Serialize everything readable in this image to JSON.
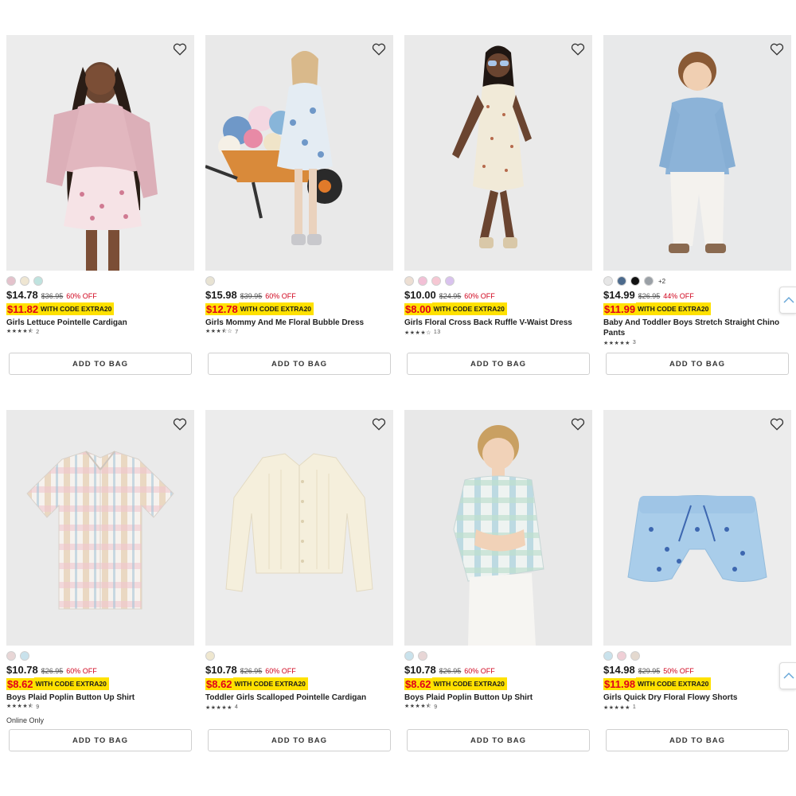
{
  "products": [
    {
      "name": "Girls Lettuce Pointelle Cardigan",
      "price": "$14.78",
      "orig": "$36.95",
      "off": "60% OFF",
      "code_price": "$11.82",
      "code_text": "WITH CODE EXTRA20",
      "reviews": "2",
      "rating": 4.5,
      "swatches": [
        "#e4c2cc",
        "#efe6d2",
        "#bfe3df"
      ],
      "more": "",
      "note": "",
      "bg": "#ececec",
      "add": "ADD TO BAG"
    },
    {
      "name": "Girls Mommy And Me Floral Bubble Dress",
      "price": "$15.98",
      "orig": "$39.95",
      "off": "60% OFF",
      "code_price": "$12.78",
      "code_text": "WITH CODE EXTRA20",
      "reviews": "7",
      "rating": 3.5,
      "swatches": [
        "#e8e3d3"
      ],
      "more": "",
      "note": "",
      "bg": "#e9e9e9",
      "add": "ADD TO BAG"
    },
    {
      "name": "Girls Floral Cross Back Ruffle V-Waist Dress",
      "price": "$10.00",
      "orig": "$24.95",
      "off": "60% OFF",
      "code_price": "$8.00",
      "code_text": "WITH CODE EXTRA20",
      "reviews": "13",
      "rating": 4,
      "swatches": [
        "#eddfd3",
        "#f2c0d6",
        "#f6c7d3",
        "#d9c2ee"
      ],
      "more": "",
      "note": "",
      "bg": "#eaeaea",
      "add": "ADD TO BAG"
    },
    {
      "name": "Baby And Toddler Boys Stretch Straight Chino Pants",
      "price": "$14.99",
      "orig": "$26.95",
      "off": "44% OFF",
      "code_price": "$11.99",
      "code_text": "WITH CODE EXTRA20",
      "reviews": "3",
      "rating": 5,
      "swatches": [
        "#e6e6e6",
        "#4c6a8c",
        "#111111",
        "#9aa0a6"
      ],
      "more": "+2",
      "note": "",
      "bg": "#e8e9ea",
      "add": "ADD TO BAG"
    },
    {
      "name": "Boys Plaid Poplin Button Up Shirt",
      "price": "$10.78",
      "orig": "$26.95",
      "off": "60% OFF",
      "code_price": "$8.62",
      "code_text": "WITH CODE EXTRA20",
      "reviews": "9",
      "rating": 4.5,
      "swatches": [
        "#e8d6d6",
        "#c9e2ec"
      ],
      "more": "",
      "note": "Online Only",
      "bg": "#eaeaea",
      "add": "ADD TO BAG"
    },
    {
      "name": "Toddler Girls Scalloped Pointelle Cardigan",
      "price": "$10.78",
      "orig": "$26.95",
      "off": "60% OFF",
      "code_price": "$8.62",
      "code_text": "WITH CODE EXTRA20",
      "reviews": "4",
      "rating": 5,
      "swatches": [
        "#efe7cf"
      ],
      "more": "",
      "note": "",
      "bg": "#ececec",
      "add": "ADD TO BAG"
    },
    {
      "name": "Boys Plaid Poplin Button Up Shirt",
      "price": "$10.78",
      "orig": "$26.95",
      "off": "60% OFF",
      "code_price": "$8.62",
      "code_text": "WITH CODE EXTRA20",
      "reviews": "9",
      "rating": 4.5,
      "swatches": [
        "#c9e2ec",
        "#e8d6d6"
      ],
      "more": "",
      "note": "",
      "bg": "#e8e8e8",
      "add": "ADD TO BAG"
    },
    {
      "name": "Girls Quick Dry Floral Flowy Shorts",
      "price": "$14.98",
      "orig": "$29.95",
      "off": "50% OFF",
      "code_price": "$11.98",
      "code_text": "WITH CODE EXTRA20",
      "reviews": "1",
      "rating": 5,
      "swatches": [
        "#c9e2ec",
        "#f0cfd6",
        "#e4d9cf"
      ],
      "more": "",
      "note": "",
      "bg": "#ececec",
      "add": "ADD TO BAG"
    }
  ],
  "icons": {
    "wishlist": "heart-outline-icon",
    "scroll": "chevron-up-icon"
  }
}
